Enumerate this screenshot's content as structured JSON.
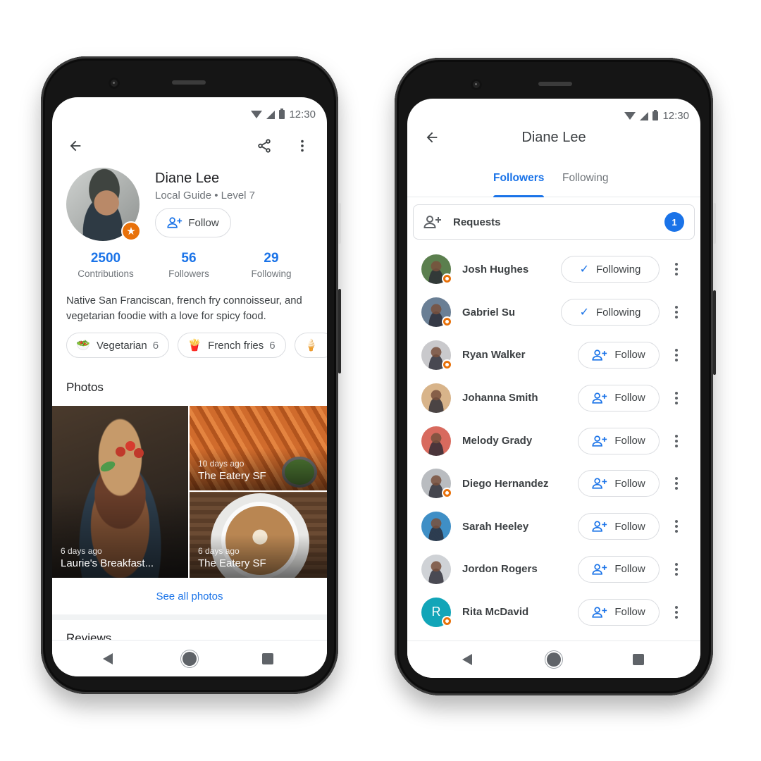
{
  "status_bar": {
    "time": "12:30"
  },
  "profile_screen": {
    "name": "Diane Lee",
    "subtitle": "Local Guide • Level 7",
    "follow_label": "Follow",
    "stats": [
      {
        "value": "2500",
        "label": "Contributions"
      },
      {
        "value": "56",
        "label": "Followers"
      },
      {
        "value": "29",
        "label": "Following"
      }
    ],
    "bio": "Native San Franciscan, french fry connoisseur, and vegetarian foodie with a love for spicy food.",
    "chips": [
      {
        "emoji": "🥗",
        "label": "Vegetarian",
        "count": "6"
      },
      {
        "emoji": "🍟",
        "label": "French fries",
        "count": "6"
      },
      {
        "emoji": "🍦",
        "label": "",
        "count": ""
      }
    ],
    "photos_title": "Photos",
    "photos": [
      {
        "ago": "6 days ago",
        "place": "Laurie's Breakfast..."
      },
      {
        "ago": "10 days ago",
        "place": "The Eatery SF"
      },
      {
        "ago": "6 days ago",
        "place": "The Eatery SF"
      }
    ],
    "see_all_label": "See all photos",
    "reviews_title": "Reviews"
  },
  "followers_screen": {
    "title": "Diane Lee",
    "tabs": [
      {
        "label": "Followers",
        "active": true
      },
      {
        "label": "Following",
        "active": false
      }
    ],
    "requests_label": "Requests",
    "requests_count": "1",
    "people": [
      {
        "name": "Josh Hughes",
        "action": "Following",
        "state": "following",
        "local_guide": true,
        "avatar_color": "#5b7f4e"
      },
      {
        "name": "Gabriel Su",
        "action": "Following",
        "state": "following",
        "local_guide": true,
        "avatar_color": "#6a7f95"
      },
      {
        "name": "Ryan Walker",
        "action": "Follow",
        "state": "follow",
        "local_guide": true,
        "avatar_color": "#c9c9cc"
      },
      {
        "name": "Johanna Smith",
        "action": "Follow",
        "state": "follow",
        "local_guide": false,
        "avatar_color": "#d8b48a"
      },
      {
        "name": "Melody Grady",
        "action": "Follow",
        "state": "follow",
        "local_guide": false,
        "avatar_color": "#d86a5e"
      },
      {
        "name": "Diego Hernandez",
        "action": "Follow",
        "state": "follow",
        "local_guide": true,
        "avatar_color": "#b9bcc0"
      },
      {
        "name": "Sarah Heeley",
        "action": "Follow",
        "state": "follow",
        "local_guide": false,
        "avatar_color": "#3f8fc6"
      },
      {
        "name": "Jordon Rogers",
        "action": "Follow",
        "state": "follow",
        "local_guide": false,
        "avatar_color": "#cfd2d6"
      },
      {
        "name": "Rita McDavid",
        "action": "Follow",
        "state": "follow",
        "local_guide": true,
        "avatar_color": "#12a5b8",
        "initial": "R"
      }
    ]
  },
  "colors": {
    "accent": "#1a73e8",
    "local_guide_orange": "#e8710a",
    "text_primary": "#202124",
    "text_secondary": "#70757a"
  }
}
